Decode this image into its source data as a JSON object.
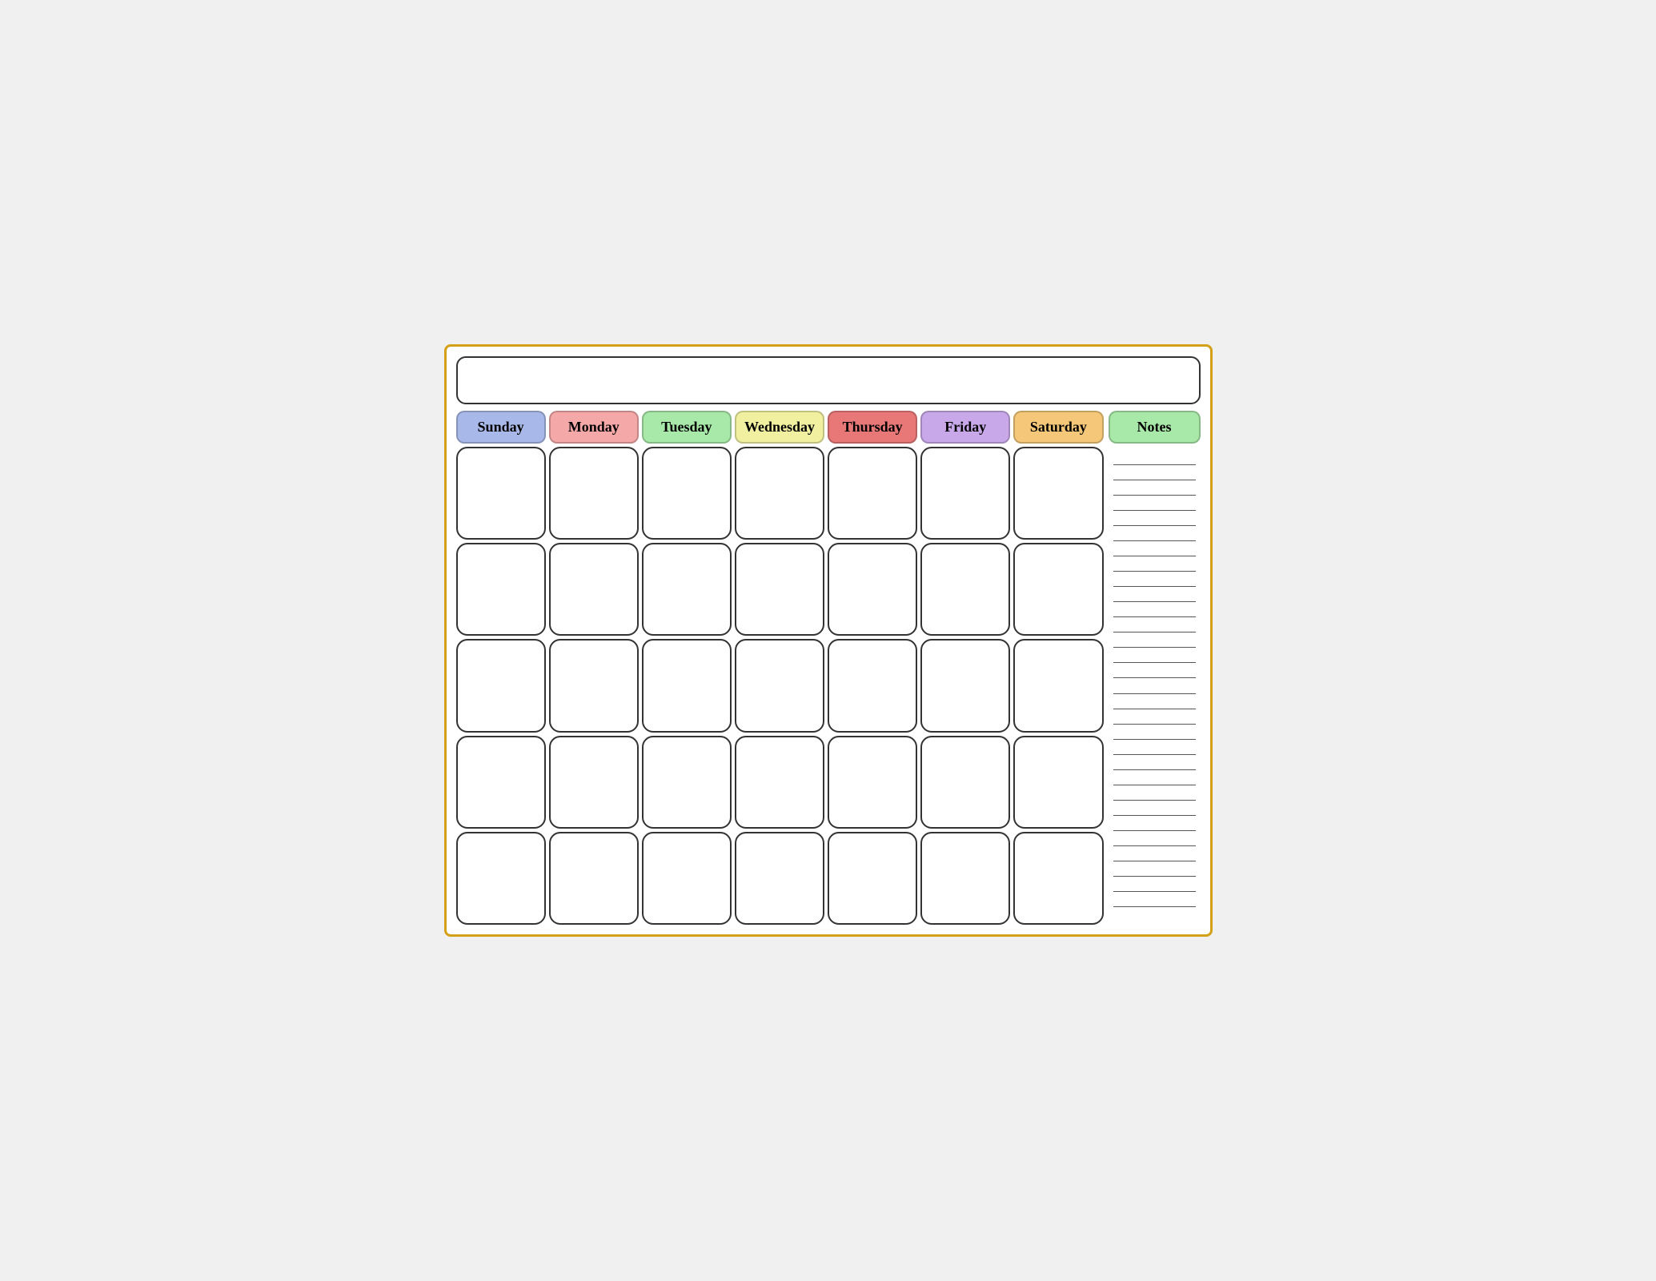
{
  "calendar": {
    "title": "",
    "days": [
      {
        "label": "Sunday",
        "class": "sunday"
      },
      {
        "label": "Monday",
        "class": "monday"
      },
      {
        "label": "Tuesday",
        "class": "tuesday"
      },
      {
        "label": "Wednesday",
        "class": "wednesday"
      },
      {
        "label": "Thursday",
        "class": "thursday"
      },
      {
        "label": "Friday",
        "class": "friday"
      },
      {
        "label": "Saturday",
        "class": "saturday"
      }
    ],
    "notes_label": "Notes",
    "rows": 5,
    "cols": 7,
    "notes_lines": 30
  }
}
